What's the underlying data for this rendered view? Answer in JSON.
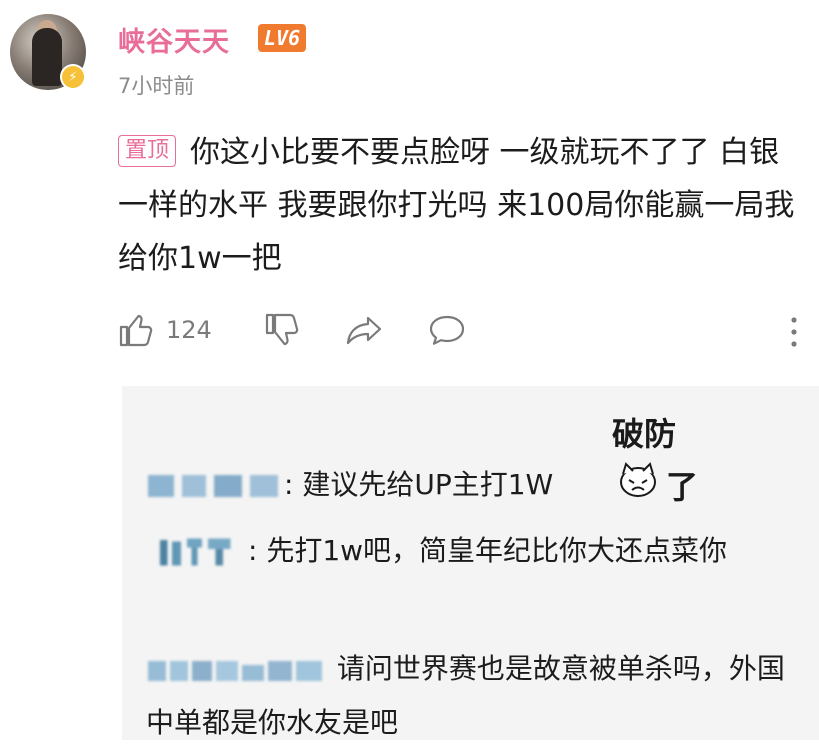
{
  "comment": {
    "username": "峡谷天天",
    "level": "LV6",
    "timestamp": "7小时前",
    "pin_tag": "置顶",
    "text": "你这小比要不要点脸呀 一级就玩不了了 白银一样的水平 我要跟你打光吗 来100局你能赢一局我给你1w一把",
    "like_count": "124",
    "icons": [
      "thumbs-up-icon",
      "thumbs-down-icon",
      "share-icon",
      "comment-icon",
      "more-icon"
    ],
    "colors": {
      "username": "#e86d98",
      "level_badge": "#f07a2e",
      "verify_badge": "#f6c136"
    }
  },
  "replies": [
    {
      "author_blurred": true,
      "separator": ":",
      "text": " 建议先给UP主打1W"
    },
    {
      "author_blurred": true,
      "separator": ":",
      "text": " 先打1w吧，简皇年纪比你大还点菜你"
    },
    {
      "author_blurred": true,
      "separator": "",
      "text": " 请问世界赛也是故意被单杀吗，外国中单都是你水友是吧"
    }
  ],
  "sticker": {
    "line1": "破防",
    "line2": "了"
  }
}
